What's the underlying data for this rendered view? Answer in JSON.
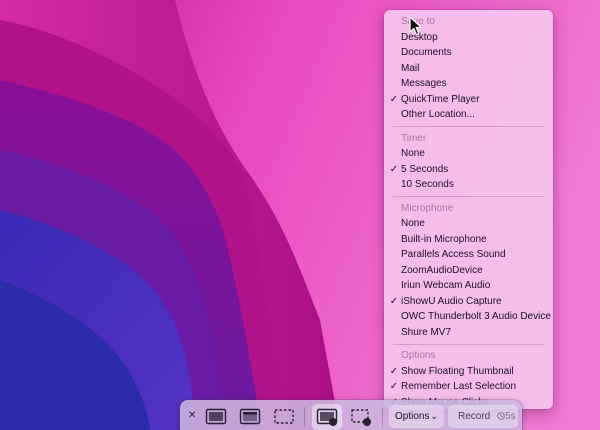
{
  "menu": {
    "sections": [
      {
        "header": "Save to",
        "items": [
          {
            "label": "Desktop",
            "checked": false
          },
          {
            "label": "Documents",
            "checked": false
          },
          {
            "label": "Mail",
            "checked": false
          },
          {
            "label": "Messages",
            "checked": false
          },
          {
            "label": "QuickTime Player",
            "checked": true
          },
          {
            "label": "Other Location...",
            "checked": false
          }
        ]
      },
      {
        "header": "Timer",
        "items": [
          {
            "label": "None",
            "checked": false
          },
          {
            "label": "5 Seconds",
            "checked": true
          },
          {
            "label": "10 Seconds",
            "checked": false
          }
        ]
      },
      {
        "header": "Microphone",
        "items": [
          {
            "label": "None",
            "checked": false
          },
          {
            "label": "Built-in Microphone",
            "checked": false
          },
          {
            "label": "Parallels Access Sound",
            "checked": false
          },
          {
            "label": "ZoomAudioDevice",
            "checked": false
          },
          {
            "label": "Iriun Webcam Audio",
            "checked": false
          },
          {
            "label": "iShowU Audio Capture",
            "checked": true
          },
          {
            "label": "OWC Thunderbolt 3 Audio Device",
            "checked": false
          },
          {
            "label": "Shure MV7",
            "checked": false
          }
        ]
      },
      {
        "header": "Options",
        "items": [
          {
            "label": "Show Floating Thumbnail",
            "checked": true
          },
          {
            "label": "Remember Last Selection",
            "checked": true
          },
          {
            "label": "Show Mouse Clicks",
            "checked": true
          }
        ]
      }
    ],
    "check_glyph": "✓"
  },
  "toolbar": {
    "close_glyph": "✕",
    "icons": [
      "capture-entire-screen-icon",
      "capture-window-icon",
      "capture-selection-icon",
      "record-entire-screen-icon",
      "record-selection-icon"
    ],
    "options_label": "Options",
    "options_chevron": "⌄",
    "record_label": "Record",
    "record_timer": "5s"
  },
  "colors": {
    "wallpaper_magenta": "#b5107e",
    "wallpaper_pink": "#e03ab8",
    "wallpaper_purple": "#5a1a9c",
    "wallpaper_blue": "#2a2ca8",
    "menu_background": "#f5c3ee",
    "menu_text": "#1c1020",
    "menu_section_header": "#a77aa2"
  }
}
